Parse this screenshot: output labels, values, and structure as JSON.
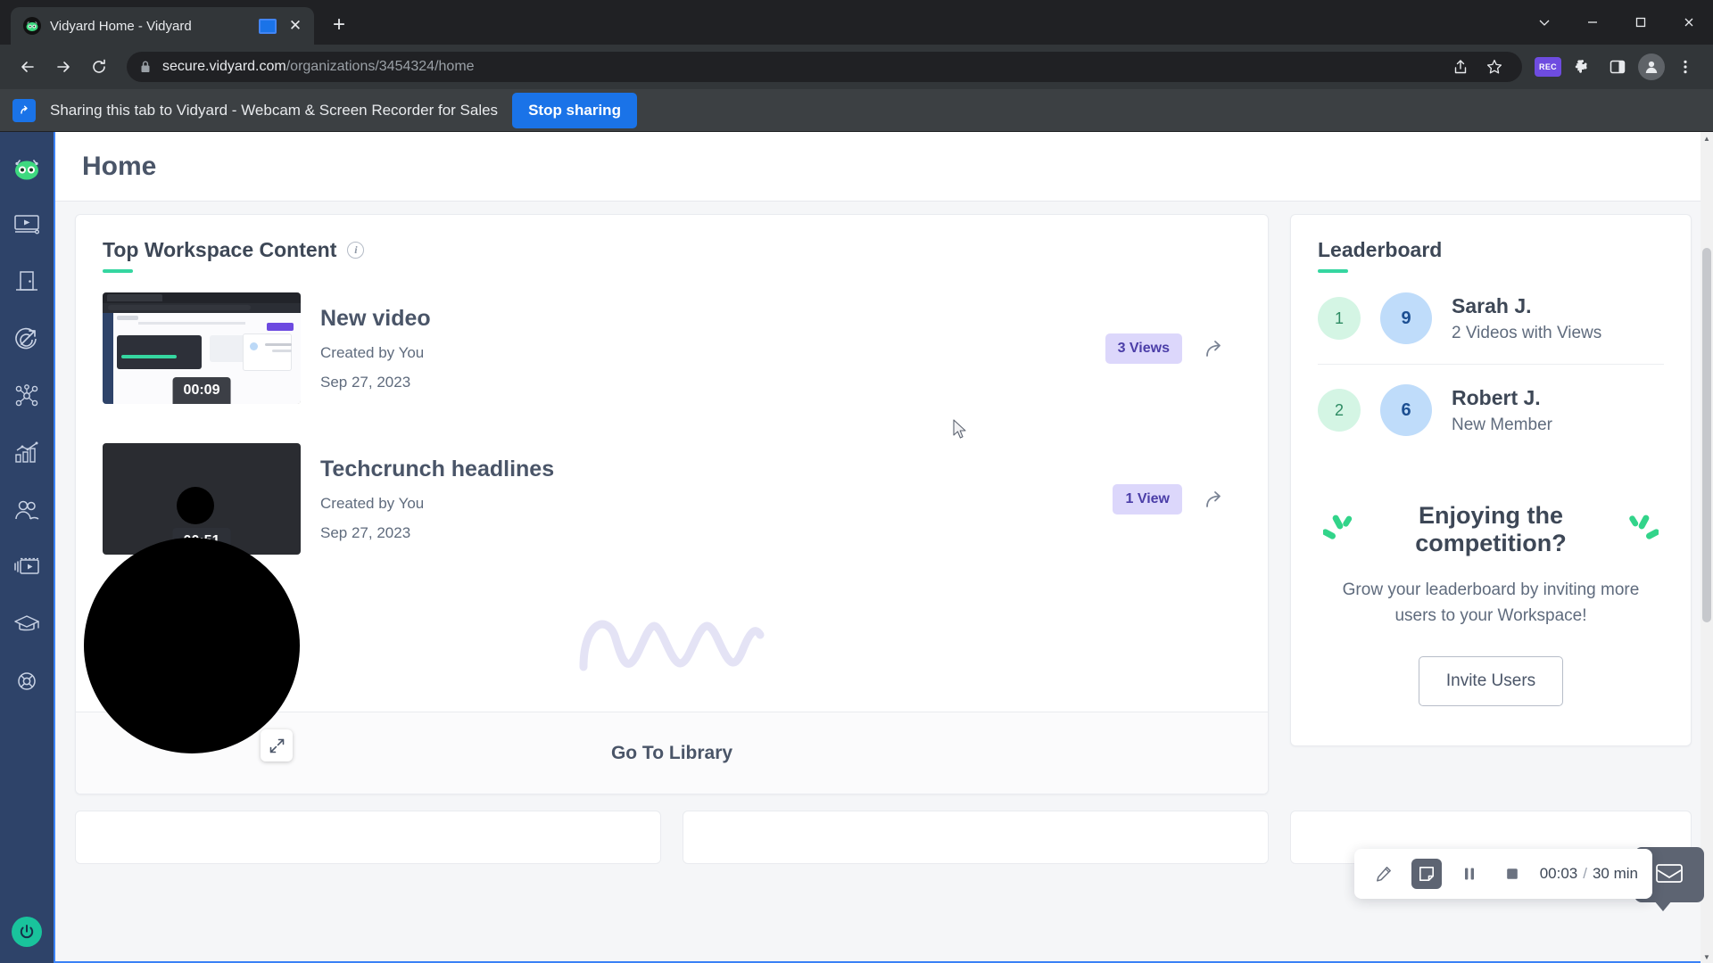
{
  "browser": {
    "tab": {
      "title": "Vidyard Home - Vidyard",
      "favicon_name": "vidyard-favicon",
      "media_indicator": "tab-casting-icon",
      "close_label": "✕"
    },
    "new_tab_label": "+",
    "window_controls": {
      "minimize": "─",
      "maximize": "□",
      "close": "✕",
      "chevron": "⌄"
    },
    "nav": {
      "back": "←",
      "forward": "→",
      "reload": "⟳"
    },
    "omnibox": {
      "lock_icon": "lock-icon",
      "url_domain": "secure.vidyard.com",
      "url_path": "/organizations/3454324/home"
    },
    "toolbar_icons": {
      "share": "share-icon",
      "bookmark": "star-icon",
      "recorder_badge": "REC",
      "extensions": "puzzle-piece-icon",
      "side_panel": "side-panel-icon",
      "profile": "profile-avatar-icon",
      "menu": "three-dot-menu-icon"
    }
  },
  "sharing_bar": {
    "icon": "screen-share-icon",
    "message": "Sharing this tab to Vidyard - Webcam & Screen Recorder for Sales",
    "stop_button": "Stop sharing",
    "accent_color": "#1a73e8"
  },
  "sidebar": {
    "background": "#2e4369",
    "items": [
      {
        "name": "vidyard-logo",
        "label": "Vidyard"
      },
      {
        "name": "video-player-icon",
        "label": "Videos"
      },
      {
        "name": "door-icon",
        "label": "Virtual Room"
      },
      {
        "name": "target-arrow-icon",
        "label": "Prospecting"
      },
      {
        "name": "network-nodes-icon",
        "label": "Integrations"
      },
      {
        "name": "bar-chart-icon",
        "label": "Analytics"
      },
      {
        "name": "people-icon",
        "label": "Team"
      },
      {
        "name": "film-strip-icon",
        "label": "Playlists"
      },
      {
        "name": "graduation-cap-icon",
        "label": "Learning"
      },
      {
        "name": "support-icon",
        "label": "Support"
      }
    ],
    "bottom_item": {
      "name": "power-record-button",
      "color": "#19c39c"
    }
  },
  "page": {
    "title": "Home",
    "top_workspace": {
      "heading": "Top Workspace Content",
      "info_icon": "info-icon",
      "accent_color": "#35d6a0",
      "videos": [
        {
          "title": "New video",
          "creator": "Created by You",
          "date": "Sep 27, 2023",
          "duration": "00:09",
          "views_badge": "3 Views",
          "share_icon": "share-arrow-icon"
        },
        {
          "title": "Techcrunch headlines",
          "creator": "Created by You",
          "date": "Sep 27, 2023",
          "duration": "00:51",
          "views_badge": "1 View",
          "share_icon": "share-arrow-icon"
        }
      ],
      "library_link": "Go To Library"
    },
    "leaderboard": {
      "heading": "Leaderboard",
      "accent_color": "#35d6a0",
      "entries": [
        {
          "rank": "1",
          "score": "9",
          "name": "Sarah J.",
          "detail": "2 Videos with Views"
        },
        {
          "rank": "2",
          "score": "6",
          "name": "Robert J.",
          "detail": "New Member"
        }
      ],
      "promo": {
        "icon": "celebration-sparkle-icon",
        "title": "Enjoying the competition?",
        "subtitle": "Grow your leaderboard by inviting more users to your Workspace!",
        "button": "Invite Users"
      }
    }
  },
  "recorder_controls": {
    "draw_icon": "pencil-icon",
    "note_icon": "sticky-note-icon",
    "pause_icon": "pause-icon",
    "stop_icon": "stop-square-icon",
    "elapsed": "00:03",
    "separator": "/",
    "total": "30 min",
    "chat_icon": "chat-bubble-icon",
    "expand_icon": "expand-arrows-icon"
  },
  "webcam_bubble": {
    "name": "webcam-bubble",
    "state": "black"
  }
}
